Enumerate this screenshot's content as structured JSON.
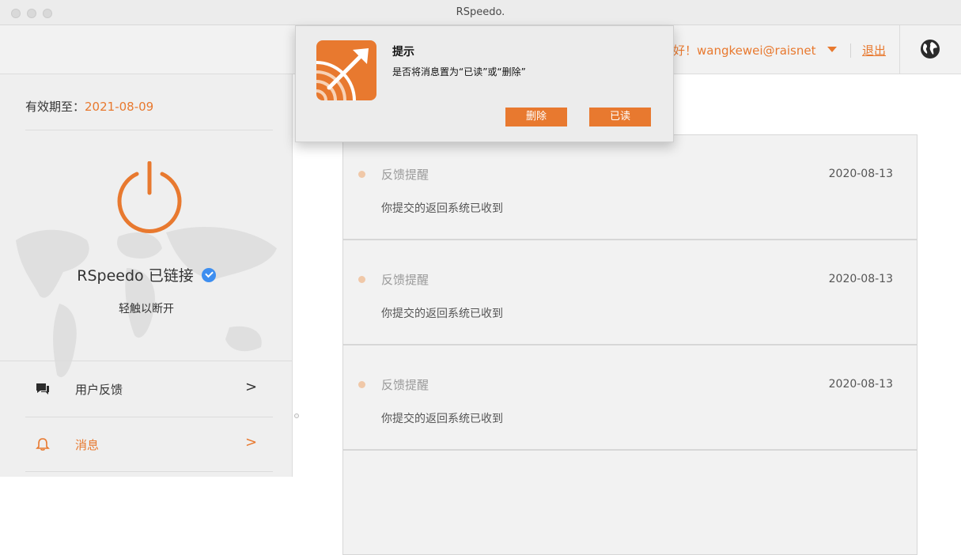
{
  "window": {
    "title": "RSpeedo."
  },
  "header": {
    "greeting": "你好！wangkewei@raisnet",
    "logout_label": "退出",
    "icons": {
      "caret": "caret-down-icon",
      "globe": "globe-icon"
    }
  },
  "sidebar": {
    "expiry_label": "有效期至：",
    "expiry_date": "2021-08-09",
    "status_text": "RSpeedo 已链接",
    "tap_hint": "轻触以断开",
    "menu": [
      {
        "label": "用户反馈",
        "icon": "chat-icon",
        "arrow": ">"
      },
      {
        "label": "消息",
        "icon": "bell-icon",
        "arrow": ">"
      }
    ]
  },
  "messages": [
    {
      "title": "反馈提醒",
      "date": "2020-08-13",
      "body": "你提交的返回系统已收到"
    },
    {
      "title": "反馈提醒",
      "date": "2020-08-13",
      "body": "你提交的返回系统已收到"
    },
    {
      "title": "反馈提醒",
      "date": "2020-08-13",
      "body": "你提交的返回系统已收到"
    }
  ],
  "dialog": {
    "title": "提示",
    "message": "是否将消息置为“已读”或“删除”",
    "delete_label": "删除",
    "read_label": "已读"
  },
  "colors": {
    "accent": "#e8792f",
    "verified": "#3d8ef0",
    "unread_dot": "#f0c8a8"
  }
}
